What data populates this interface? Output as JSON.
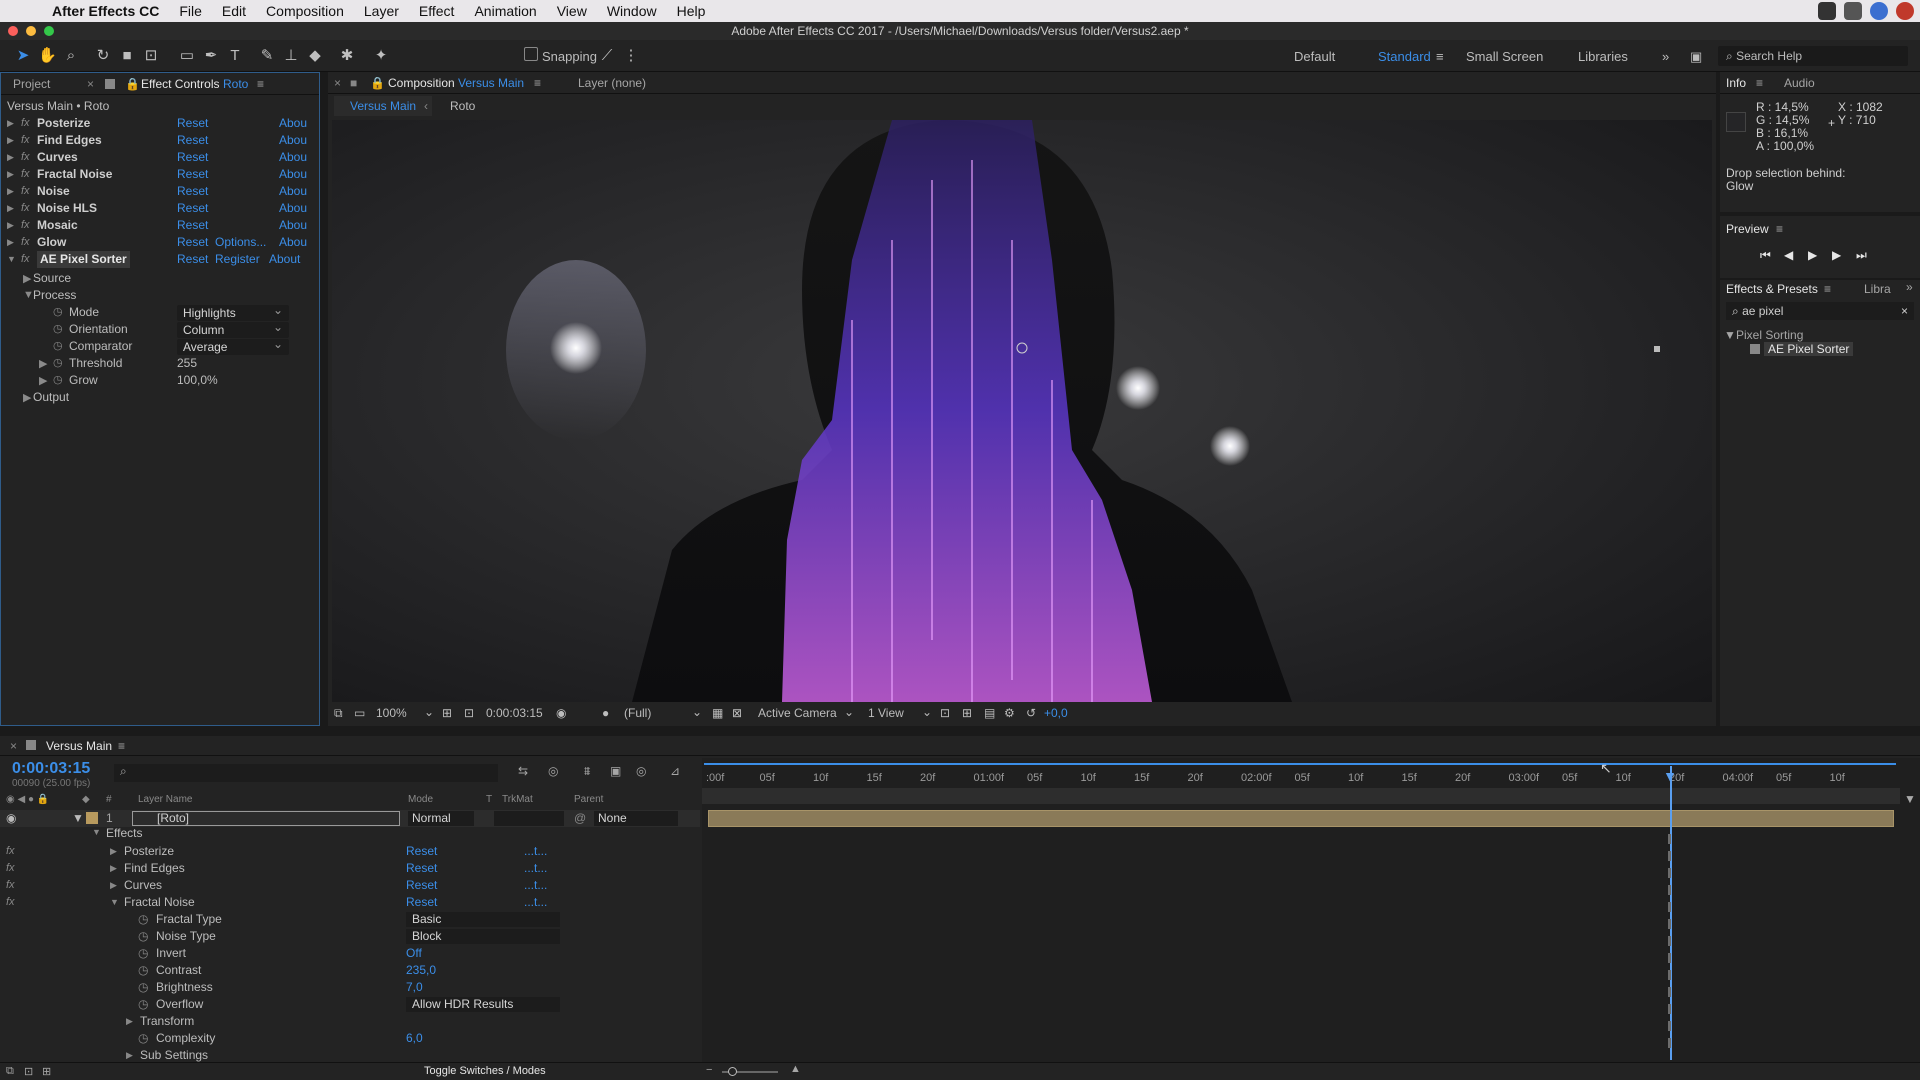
{
  "menubar": {
    "app": "After Effects CC",
    "items": [
      "File",
      "Edit",
      "Composition",
      "Layer",
      "Effect",
      "Animation",
      "View",
      "Window",
      "Help"
    ]
  },
  "titlebar": {
    "title": "Adobe After Effects CC 2017 - /Users/Michael/Downloads/Versus folder/Versus2.aep *"
  },
  "toolbar": {
    "snapping": "Snapping",
    "workspaces": [
      "Default",
      "Standard",
      "Small Screen",
      "Libraries"
    ],
    "active_workspace": "Standard",
    "search_placeholder": "Search Help"
  },
  "project_panel": {
    "tab_project": "Project",
    "tab_effect_controls": "Effect Controls",
    "tab_effect_target": "Roto",
    "breadcrumb": "Versus Main • Roto"
  },
  "effects": [
    {
      "name": "Posterize",
      "reset": "Reset",
      "about": "Abou"
    },
    {
      "name": "Find Edges",
      "reset": "Reset",
      "about": "Abou"
    },
    {
      "name": "Curves",
      "reset": "Reset",
      "about": "Abou"
    },
    {
      "name": "Fractal Noise",
      "reset": "Reset",
      "about": "Abou"
    },
    {
      "name": "Noise",
      "reset": "Reset",
      "about": "Abou"
    },
    {
      "name": "Noise HLS",
      "reset": "Reset",
      "about": "Abou"
    },
    {
      "name": "Mosaic",
      "reset": "Reset",
      "about": "Abou"
    },
    {
      "name": "Glow",
      "reset": "Reset",
      "options": "Options...",
      "about": "Abou"
    },
    {
      "name": "AE Pixel Sorter",
      "reset": "Reset",
      "register": "Register",
      "about": "About"
    }
  ],
  "pixel_sorter": {
    "source": "Source",
    "process": "Process",
    "mode_label": "Mode",
    "mode_value": "Highlights",
    "orientation_label": "Orientation",
    "orientation_value": "Column",
    "comparator_label": "Comparator",
    "comparator_value": "Average",
    "threshold_label": "Threshold",
    "threshold_value": "255",
    "grow_label": "Grow",
    "grow_value": "100,0%",
    "output": "Output"
  },
  "composition": {
    "tab_label": "Composition",
    "tab_name": "Versus Main",
    "layer_tab": "Layer (none)",
    "crumbs": [
      "Versus Main",
      "Roto"
    ],
    "zoom": "100%",
    "timecode": "0:00:03:15",
    "resolution": "(Full)",
    "camera": "Active Camera",
    "views": "1 View",
    "exposure": "+0,0"
  },
  "info_panel": {
    "tab_info": "Info",
    "tab_audio": "Audio",
    "r": "R : 14,5%",
    "g": "G : 14,5%",
    "b": "B : 16,1%",
    "a": "A : 100,0%",
    "x": "X : 1082",
    "y": "Y : 710",
    "drop_text": "Drop selection behind:",
    "drop_target": "Glow"
  },
  "preview_panel": {
    "title": "Preview"
  },
  "effects_presets": {
    "title": "Effects & Presets",
    "libra": "Libra",
    "search_value": "ae pixel",
    "category": "Pixel Sorting",
    "item": "AE Pixel Sorter"
  },
  "timeline": {
    "comp_name": "Versus Main",
    "timecode": "0:00:03:15",
    "frame_info": "00090 (25.00 fps)",
    "col_layer_name": "Layer Name",
    "col_mode": "Mode",
    "col_t": "T",
    "col_trkmat": "TrkMat",
    "col_parent": "Parent",
    "layer_number": "1",
    "layer_name": "[Roto]",
    "layer_mode": "Normal",
    "layer_parent": "None",
    "effects_group": "Effects",
    "toggle_label": "Toggle Switches / Modes",
    "ruler": [
      ":00f",
      "05f",
      "10f",
      "15f",
      "20f",
      "01:00f",
      "05f",
      "10f",
      "15f",
      "20f",
      "02:00f",
      "05f",
      "10f",
      "15f",
      "20f",
      "03:00f",
      "05f",
      "10f",
      "20f",
      "04:00f",
      "05f",
      "10f"
    ],
    "effect_rows": [
      {
        "name": "Posterize",
        "reset": "Reset",
        "dots": "...t..."
      },
      {
        "name": "Find Edges",
        "reset": "Reset",
        "dots": "...t..."
      },
      {
        "name": "Curves",
        "reset": "Reset",
        "dots": "...t..."
      },
      {
        "name": "Fractal Noise",
        "reset": "Reset",
        "dots": "...t..."
      }
    ],
    "fractal_props": [
      {
        "name": "Fractal Type",
        "value": "Basic",
        "kind": "dd"
      },
      {
        "name": "Noise Type",
        "value": "Block",
        "kind": "dd"
      },
      {
        "name": "Invert",
        "value": "Off",
        "kind": "val"
      },
      {
        "name": "Contrast",
        "value": "235,0",
        "kind": "val"
      },
      {
        "name": "Brightness",
        "value": "7,0",
        "kind": "val"
      },
      {
        "name": "Overflow",
        "value": "Allow HDR Results",
        "kind": "dd"
      },
      {
        "name": "Transform",
        "value": "",
        "kind": "grp"
      },
      {
        "name": "Complexity",
        "value": "6,0",
        "kind": "val"
      },
      {
        "name": "Sub Settings",
        "value": "",
        "kind": "grp"
      }
    ]
  },
  "colors": {
    "accent_blue": "#3b8ee8",
    "layer_bar": "#8a7a58",
    "playhead": "#5a9ff0"
  }
}
